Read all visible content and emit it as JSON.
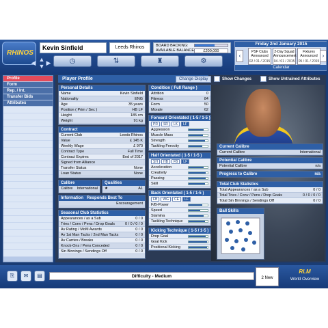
{
  "header": {
    "logo_text": "RHINOS",
    "player_name": "Kevin Sinfield",
    "club": "Leeds Rhinos",
    "board_backing_label": "BOARD BACKING:",
    "board_backing_level": 0.6,
    "available_balance_label": "AVAILABLE BALANCE:",
    "available_balance": "£200,000",
    "date": "Friday 2nd January 2015",
    "events": [
      {
        "title": "PSF Clubs Announced",
        "date": "02 / 01 / 2015"
      },
      {
        "title": "2-Day Squad Announcement",
        "date": "04 / 01 / 2015"
      },
      {
        "title": "Fixtures Announced",
        "date": "05 / 01 / 2015"
      }
    ],
    "calendar_label": "Calendar"
  },
  "sidebar": {
    "items": [
      {
        "label": "Profile",
        "active": true
      },
      {
        "label": "Form",
        "active": false
      },
      {
        "label": "Rep. / Int.",
        "active": false
      },
      {
        "label": "Transfer Bids",
        "active": false
      },
      {
        "label": "Attributes",
        "active": false
      }
    ]
  },
  "main": {
    "title": "Player Profile",
    "change_display": "Change Display",
    "show_changes": "Show Changes",
    "show_untrained": "Show Untrained Attributes",
    "personal": {
      "title": "Personal Details",
      "rows": [
        {
          "k": "Name",
          "v": "Kevin Sinfield"
        },
        {
          "k": "Nationality",
          "v": "ENG"
        },
        {
          "k": "Age",
          "v": "35 years"
        },
        {
          "k": "Position ( Prim / Sec )",
          "v": "HB  LF"
        },
        {
          "k": "Height",
          "v": "185 cm"
        },
        {
          "k": "Weight",
          "v": "91 kg"
        }
      ]
    },
    "contract": {
      "title": "Contract",
      "rows": [
        {
          "k": "Current Club",
          "v": "Leeds Rhinos"
        },
        {
          "k": "Value",
          "v": "£ 145 K"
        },
        {
          "k": "Weekly Wage",
          "v": "£ 970"
        },
        {
          "k": "Contract Type",
          "v": "Full Time"
        },
        {
          "k": "Contract Expires",
          "v": "End of 2017"
        },
        {
          "k": "Signed from Alliance",
          "v": ""
        },
        {
          "k": "Transfer Status",
          "v": "None"
        },
        {
          "k": "Loan Status",
          "v": "None"
        }
      ]
    },
    "calibre": {
      "title": "Calibre",
      "value": "International"
    },
    "qualities": {
      "title": "Qualities",
      "value": "A1"
    },
    "information": {
      "title": "Information",
      "note": "Responds Best To",
      "value": "Encouragement"
    },
    "seasonal": {
      "title": "Seasonal Club Statistics",
      "rows": [
        {
          "k": "Appearances / as a Sub",
          "v": "0 / 0"
        },
        {
          "k": "Tries / Conv / Pens / Drop Goals",
          "v": "0 / 0 / 0 / 0"
        },
        {
          "k": "Av Rating / MoM Awards",
          "v": "0 / 0"
        },
        {
          "k": "Av 1st Man Tacks / 2nd Man Tacks",
          "v": "0 / 0"
        },
        {
          "k": "Av Carries / Breaks",
          "v": "0 / 0"
        },
        {
          "k": "Knock-Ons / Pens Conceded",
          "v": "0 / 0"
        },
        {
          "k": "Sin Binnings / Sendings Off",
          "v": "0 / 0"
        }
      ]
    },
    "condition": {
      "title": "Condition ( Full Range )",
      "rows": [
        {
          "k": "Attrition",
          "v": "0"
        },
        {
          "k": "Fitness",
          "v": "84"
        },
        {
          "k": "Form",
          "v": "50"
        },
        {
          "k": "Morale",
          "v": "62"
        }
      ]
    },
    "forward": {
      "title": "Forward Orientated ( 1-5 / 1-5 )",
      "tags": [
        "PR",
        "SR",
        "LK",
        "LF"
      ],
      "rows": [
        {
          "k": "Aggression",
          "level": 0.8
        },
        {
          "k": "Muscle Mass",
          "level": 0.75
        },
        {
          "k": "Strength",
          "level": 0.85
        },
        {
          "k": "Tackling Ferocity",
          "level": 0.7
        }
      ]
    },
    "half": {
      "title": "Half Orientated ( 1-5 / 1-5 )",
      "tags": [
        "SH",
        "HB",
        "FB",
        "LF"
      ],
      "rows": [
        {
          "k": "Acceleration",
          "level": 0.8
        },
        {
          "k": "Creativity",
          "level": 0.9
        },
        {
          "k": "Passing",
          "level": 0.9
        },
        {
          "k": "Skill",
          "level": 0.85
        }
      ]
    },
    "back": {
      "title": "Back Orientated ( 1-5 / 1-5 )",
      "tags": [
        "FB",
        "WG",
        "CE",
        "LF"
      ],
      "rows": [
        {
          "k": "F/B-Power",
          "level": 0.7
        },
        {
          "k": "Speed",
          "level": 0.6
        },
        {
          "k": "Stamina",
          "level": 0.8
        },
        {
          "k": "Tackling Technique",
          "level": 0.85
        }
      ]
    },
    "kicking": {
      "title": "Kicking Technique ( 1-5 / 1-5 )",
      "rows": [
        {
          "k": "Drop Goal",
          "level": 0.9
        },
        {
          "k": "Goal Kick",
          "level": 0.95
        },
        {
          "k": "Positional Kicking",
          "level": 0.95
        }
      ]
    },
    "current_calibre": {
      "title": "Current Calibre",
      "k": "Current Calibre",
      "v": "International"
    },
    "potential_calibre": {
      "title": "Potential Calibre",
      "k": "Potential Calibre",
      "v": "n/a"
    },
    "progress": {
      "title": "Progress to Calibre",
      "v": "n/a"
    },
    "total": {
      "title": "Total Club Statistics",
      "rows": [
        {
          "k": "Total Appearances / as a Sub",
          "v": "0 / 0"
        },
        {
          "k": "Total Tries / Conv / Pens / Drop Goals",
          "v": "0 / 0 / 0 / 0"
        },
        {
          "k": "Total Sin Binnings / Sendings Off",
          "v": "0 / 0"
        }
      ]
    },
    "ball_skills": {
      "title": "Ball Skills"
    }
  },
  "footer": {
    "difficulty": "Difficulty - Medium",
    "next_label": "2 New",
    "world_logo": "RLM",
    "world_label": "World Overview"
  }
}
